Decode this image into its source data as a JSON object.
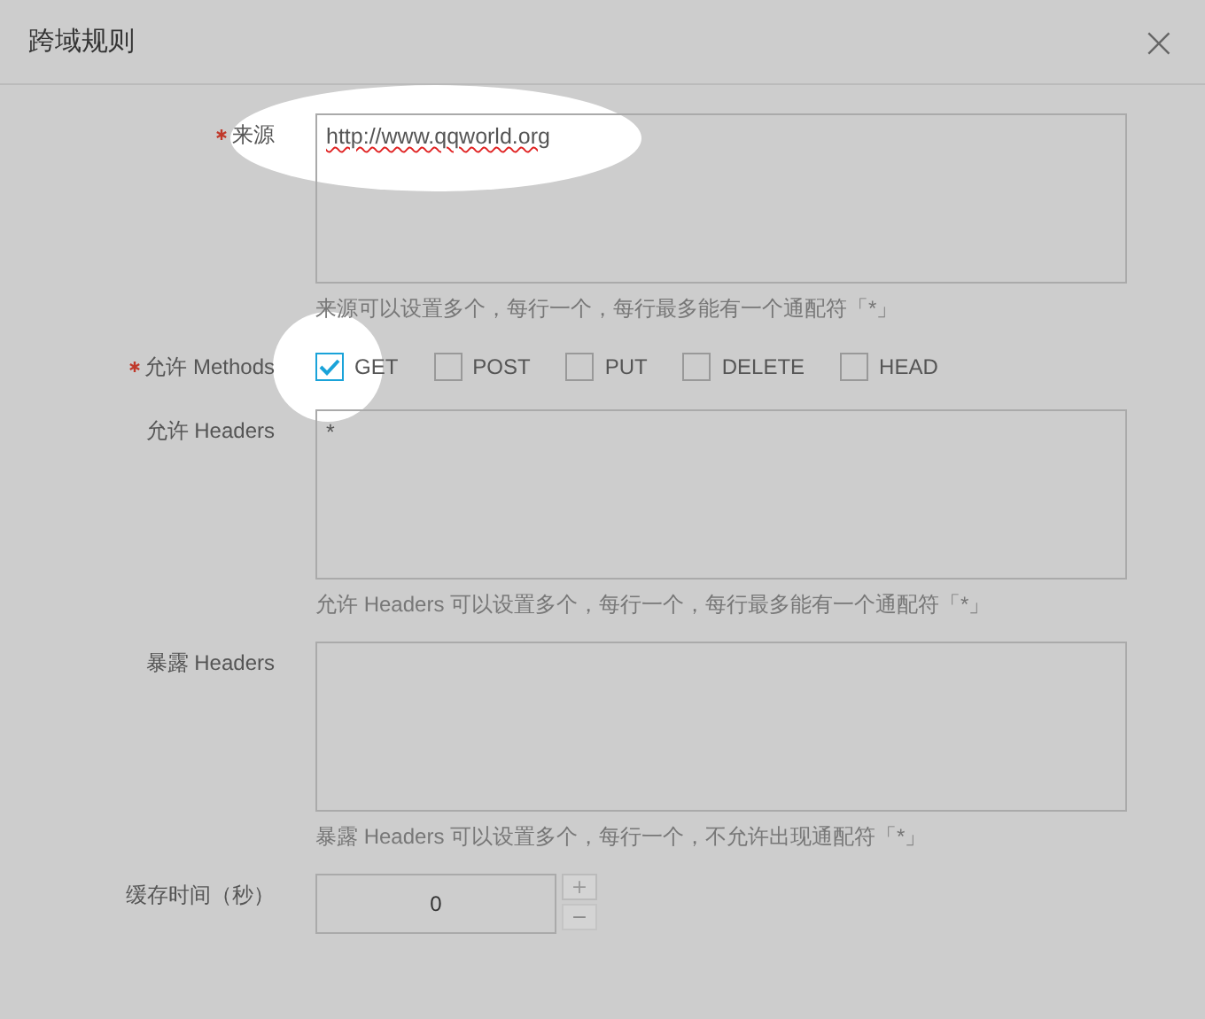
{
  "dialog": {
    "title": "跨域规则",
    "close": "×"
  },
  "fields": [
    {
      "kind": "textarea",
      "label": "来源",
      "required": true,
      "value": "http://www.qqworld.org",
      "spellcheck_error": true,
      "hint": "来源可以设置多个，每行一个，每行最多能有一个通配符「*」"
    },
    {
      "kind": "checkboxes",
      "label": "允许 Methods",
      "required": true,
      "options": [
        {
          "label": "GET",
          "checked": true
        },
        {
          "label": "POST",
          "checked": false
        },
        {
          "label": "PUT",
          "checked": false
        },
        {
          "label": "DELETE",
          "checked": false
        },
        {
          "label": "HEAD",
          "checked": false
        }
      ]
    },
    {
      "kind": "textarea",
      "label": "允许 Headers",
      "required": false,
      "value": "*",
      "hint": "允许 Headers 可以设置多个，每行一个，每行最多能有一个通配符「*」"
    },
    {
      "kind": "textarea",
      "label": "暴露 Headers",
      "required": false,
      "hint": "暴露 Headers 可以设置多个，每行一个，不允许出现通配符「*」"
    },
    {
      "kind": "number",
      "label": "缓存时间（秒）",
      "required": false,
      "value": "0",
      "plus": "+",
      "minus": "−"
    }
  ]
}
